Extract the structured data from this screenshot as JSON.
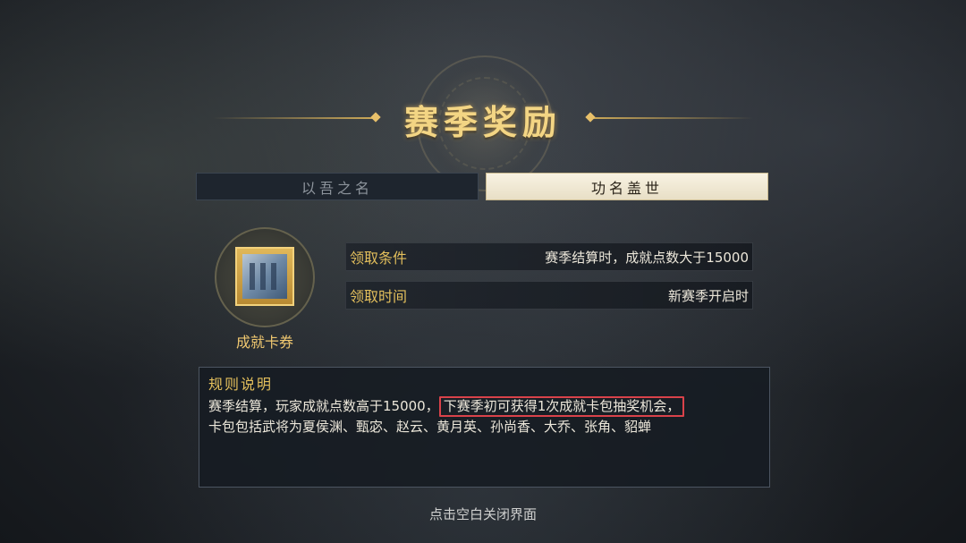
{
  "title": "赛季奖励",
  "tabs": [
    {
      "label": "以吾之名",
      "active": false
    },
    {
      "label": "功名盖世",
      "active": true
    }
  ],
  "reward": {
    "name": "成就卡券",
    "icon": "card-pack-icon"
  },
  "info": [
    {
      "label": "领取条件",
      "value": "赛季结算时，成就点数大于15000"
    },
    {
      "label": "领取时间",
      "value": "新赛季开启时"
    }
  ],
  "rules": {
    "title": "规则说明",
    "line1_pre": "赛季结算，玩家成就点数高于15000，",
    "line1_highlight": "下赛季初可获得1次成就卡包抽奖机会，",
    "line2": "卡包包括武将为夏侯渊、甄宓、赵云、黄月英、孙尚香、大乔、张角、貂蝉"
  },
  "close_hint": "点击空白关闭界面",
  "colors": {
    "gold": "#e3bf5c",
    "highlight_border": "#d9424a",
    "tab_active_bg": "#f5eedb",
    "tab_inactive_bg": "#1e252e"
  }
}
